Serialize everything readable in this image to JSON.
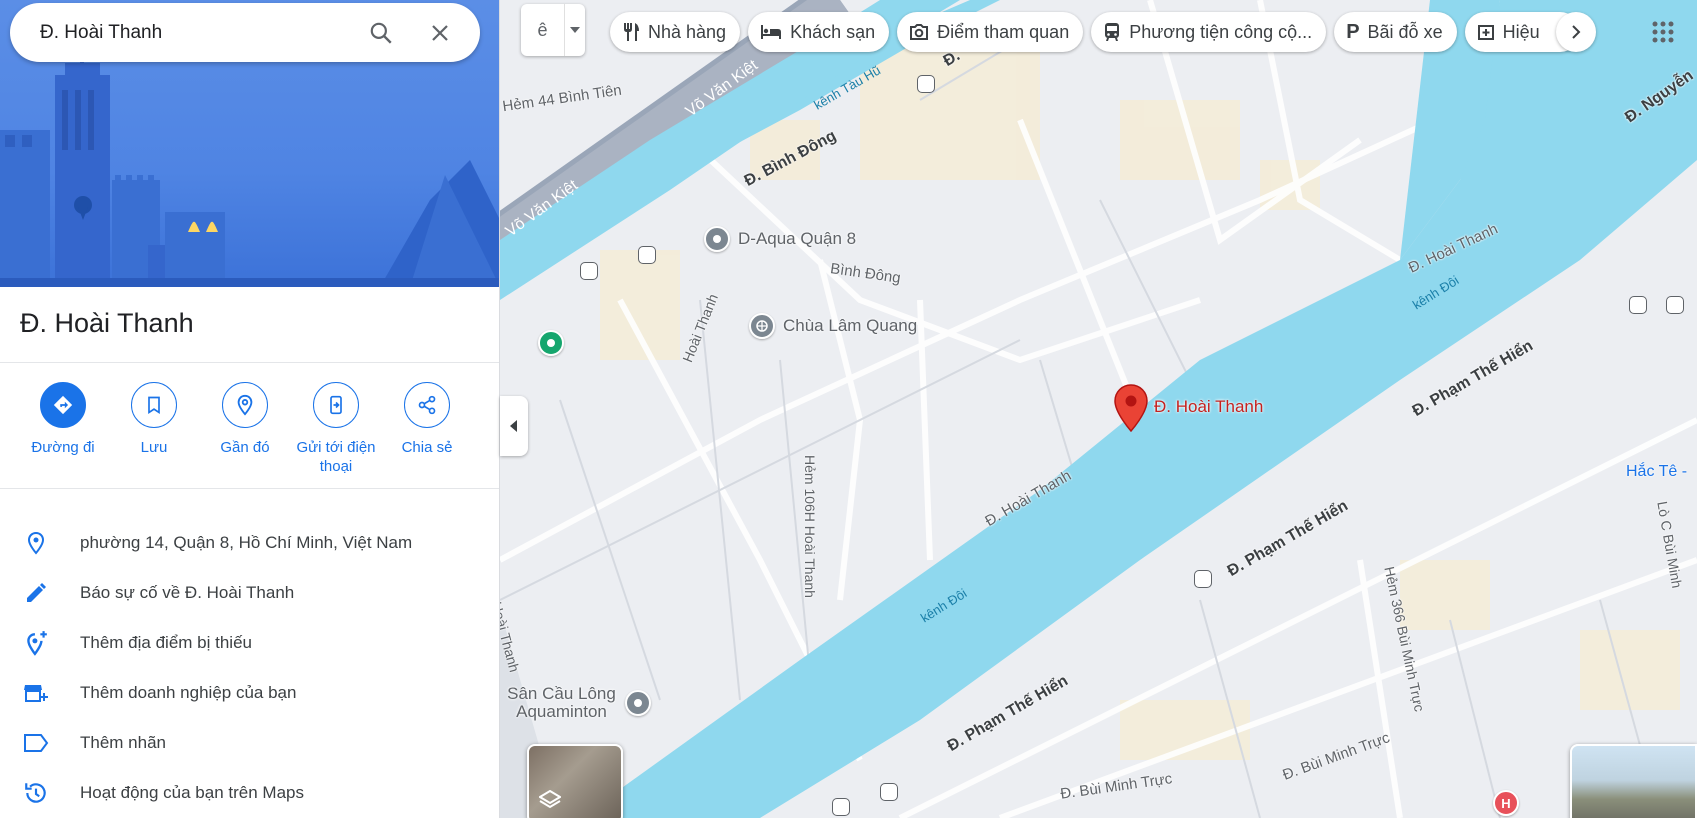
{
  "search": {
    "value": "Đ. Hoài Thanh"
  },
  "place": {
    "title": "Đ. Hoài Thanh"
  },
  "actions": [
    {
      "label": "Đường đi",
      "icon": "directions-icon"
    },
    {
      "label": "Lưu",
      "icon": "bookmark-icon"
    },
    {
      "label": "Gần đó",
      "icon": "nearby-icon"
    },
    {
      "label": "Gửi tới điện thoại",
      "icon": "send-to-phone-icon"
    },
    {
      "label": "Chia sẻ",
      "icon": "share-icon"
    }
  ],
  "info": [
    {
      "text": "phường 14, Quận 8, Hồ Chí Minh, Việt Nam",
      "icon": "location-pin-icon"
    },
    {
      "text": "Báo sự cố về Đ. Hoài Thanh",
      "icon": "pencil-icon"
    },
    {
      "text": "Thêm địa điểm bị thiếu",
      "icon": "add-location-icon"
    },
    {
      "text": "Thêm doanh nghiệp của bạn",
      "icon": "add-business-icon"
    },
    {
      "text": "Thêm nhãn",
      "icon": "label-icon"
    },
    {
      "text": "Hoạt động của bạn trên Maps",
      "icon": "history-icon"
    }
  ],
  "chips": [
    {
      "label": "Nhà hàng",
      "icon": "restaurant-icon"
    },
    {
      "label": "Khách sạn",
      "icon": "hotel-icon"
    },
    {
      "label": "Điểm tham quan",
      "icon": "camera-icon"
    },
    {
      "label": "Phương tiện công cộ...",
      "icon": "transit-icon"
    },
    {
      "label": "Bãi đỗ xe",
      "icon": "parking-icon"
    },
    {
      "label": "Hiệu",
      "icon": "pharmacy-icon"
    }
  ],
  "map": {
    "pin_label": "Đ. Hoài Thanh",
    "street_labels": [
      "Hẻm 44 Bình Tiên",
      "Võ Văn Kiệt",
      "Võ Văn Kiệt",
      "Đ. Bình Đông",
      "Bình Đông",
      "Hoài Thanh",
      "Hẻm 106H Hoài Thanh",
      "Đ. Hoài Thanh",
      "Đ. Hoài Thanh",
      "Đ. Phạm Thế Hiển",
      "Đ. Phạm Thế Hiển",
      "Đ. Phạm Thế Hiển",
      "Hẻm 366 Bùi Minh Trực",
      "Đ. Bùi Minh Trực",
      "Đ. Bùi Minh Trực",
      "Đ. Nguyễn",
      "Lò C Bùi Minh",
      "Đ.",
      "Hoài Thanh",
      "Hắc Tê -"
    ],
    "water_labels": [
      "kênh Tàu Hũ",
      "kênh Đôi",
      "kênh Đôi"
    ],
    "pois": [
      "D-Aqua Quận 8",
      "Chùa Lâm Quang",
      "Sân Cầu Lông Aquaminton"
    ]
  },
  "colors": {
    "accent": "#1a73e8",
    "water": "#8fd8ee",
    "pin": "#ea4335"
  }
}
